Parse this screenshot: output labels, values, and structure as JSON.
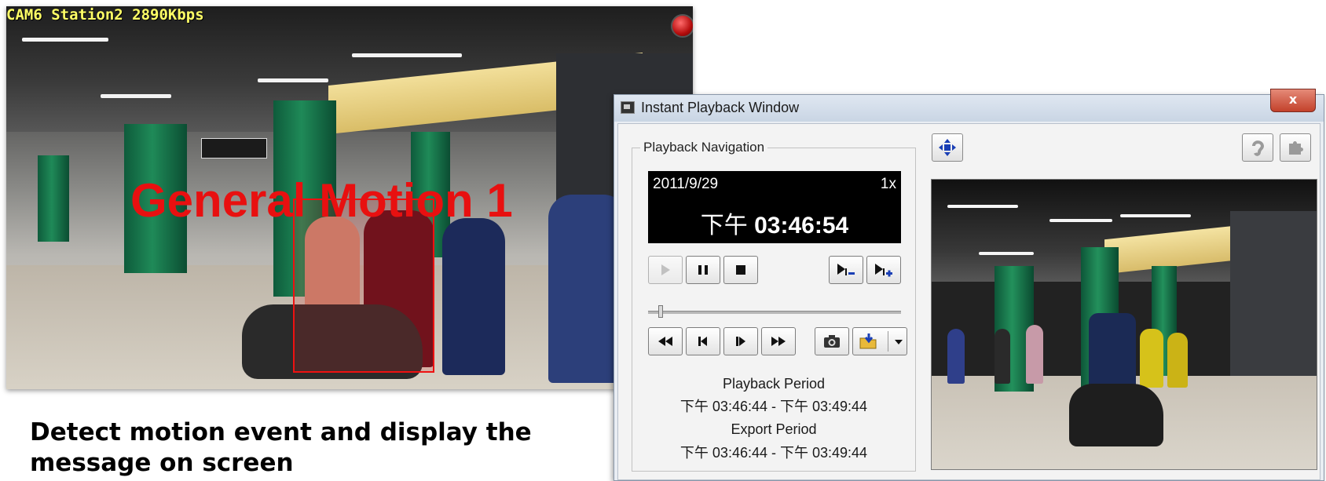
{
  "camera": {
    "title": "CAM6 Station2 2890Kbps",
    "motion_label": "General Motion 1",
    "record_indicator_color": "#cc1111",
    "motion_color": "#e81010"
  },
  "caption": "Detect motion event and display the message on screen",
  "playback_window": {
    "title": "Instant Playback Window",
    "close_label": "x",
    "navigation": {
      "legend": "Playback Navigation",
      "display": {
        "date": "2011/9/29",
        "speed": "1x",
        "ampm": "下午",
        "time": "03:46:54"
      },
      "playback_period_label": "Playback Period",
      "playback_period_value": "下午 03:46:44 - 下午 03:49:44",
      "export_period_label": "Export Period",
      "export_period_value": "下午 03:46:44 - 下午 03:49:44",
      "slider_position_fraction": 0.05
    },
    "icons": {
      "play": "play-icon",
      "pause": "pause-icon",
      "stop": "stop-icon",
      "slower": "slower-icon",
      "faster": "faster-icon",
      "rewind": "fast-rewind-icon",
      "step_back": "step-back-icon",
      "step_forward": "step-forward-icon",
      "fast_forward": "fast-forward-icon",
      "snapshot": "camera-icon",
      "export": "folder-download-icon",
      "dropdown": "chevron-down-icon",
      "ptz": "ptz-move-icon",
      "ear": "ear-icon",
      "puzzle": "puzzle-icon"
    }
  }
}
